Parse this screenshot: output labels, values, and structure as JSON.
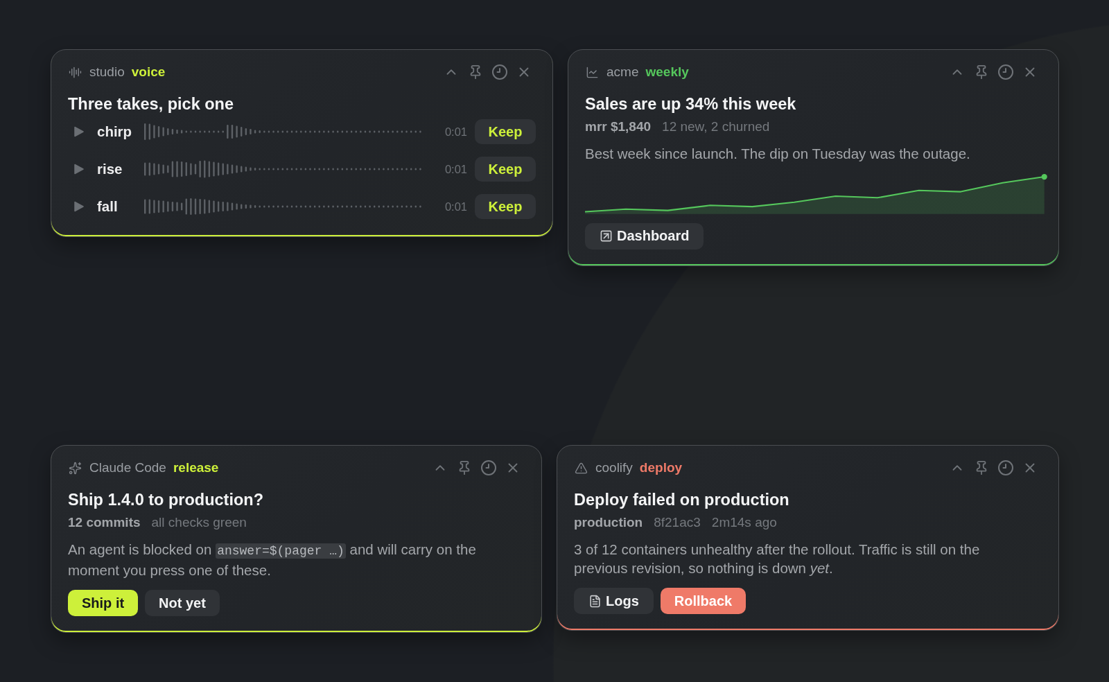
{
  "cards": [
    {
      "kind": "takes",
      "source": "studio",
      "tag": "voice",
      "color": "#cdf03a",
      "title": "Three takes, pick one",
      "takes": [
        {
          "name": "chirp",
          "duration": "0:01",
          "action": "Keep"
        },
        {
          "name": "rise",
          "duration": "0:01",
          "action": "Keep"
        },
        {
          "name": "fall",
          "duration": "0:01",
          "action": "Keep"
        }
      ]
    },
    {
      "kind": "chart",
      "source": "acme",
      "tag": "weekly",
      "color": "#55c75c",
      "title": "Sales are up 34% this week",
      "meta": {
        "primary": "mrr $1,840",
        "details": [
          "12 new, 2 churned"
        ]
      },
      "body": [
        {
          "kind": "text",
          "text": "Best week since launch. The dip on Tuesday was the outage."
        }
      ],
      "actions": [
        {
          "kind": "external",
          "label": "Dashboard"
        }
      ]
    },
    {
      "kind": "approval",
      "source": "Claude Code",
      "tag": "release",
      "color": "#cdf03a",
      "title": "Ship 1.4.0 to production?",
      "meta": {
        "primary": "12 commits",
        "details": [
          "all checks green"
        ]
      },
      "body": [
        {
          "kind": "text",
          "text": "An agent is blocked on"
        },
        {
          "kind": "code",
          "text": "answer=$(pager …)"
        },
        {
          "kind": "text",
          "text": "and will carry on the moment you press one of these."
        }
      ],
      "actions": [
        {
          "kind": "primary",
          "label": "Ship it"
        },
        {
          "kind": "plain",
          "label": "Not yet"
        }
      ]
    },
    {
      "kind": "alert",
      "source": "coolify",
      "tag": "deploy",
      "color": "#ef7a68",
      "title": "Deploy failed on production",
      "meta": {
        "primary": "production",
        "details": [
          "8f21ac3",
          "2m14s ago"
        ]
      },
      "body": [
        {
          "kind": "text",
          "text": "3 of 12 containers unhealthy after the rollout. Traffic is still on the previous revision, so nothing is down *yet*."
        }
      ],
      "actions": [
        {
          "kind": "document",
          "label": "Logs"
        },
        {
          "kind": "primary",
          "label": "Rollback"
        }
      ]
    }
  ]
}
